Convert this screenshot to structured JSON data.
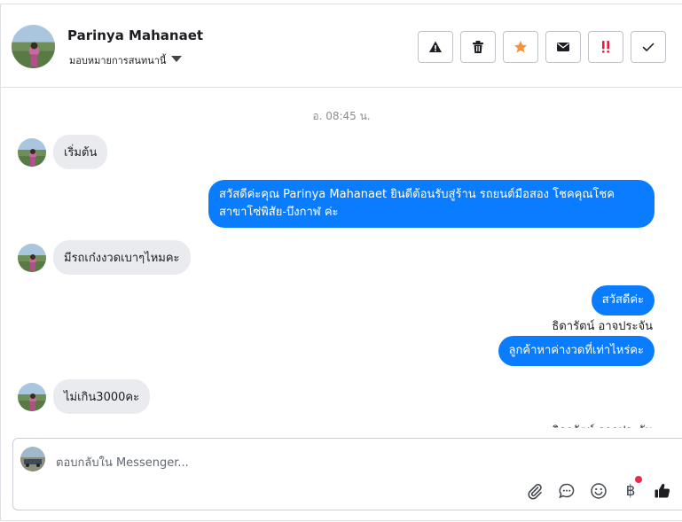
{
  "header": {
    "contact_name": "Parinya Mahanaet",
    "assign_label": "มอบหมายการสนทนานี้",
    "actions": [
      {
        "icon": "warning-icon",
        "color": "#1c1e21"
      },
      {
        "icon": "trash-icon",
        "color": "#1c1e21"
      },
      {
        "icon": "star-icon",
        "color": "#f7923a"
      },
      {
        "icon": "mail-icon",
        "color": "#1c1e21"
      },
      {
        "icon": "exclamation-icon",
        "color": "#e41e3f"
      },
      {
        "icon": "check-icon",
        "color": "#1c1e21"
      }
    ]
  },
  "conversation": {
    "timestamp": "อ. 08:45 น.",
    "messages": [
      {
        "direction": "in",
        "text": "เริ่มต้น"
      },
      {
        "direction": "out",
        "text": "สวัสดีค่ะคุณ Parinya Mahanaet ยินดีต้อนรับสู่ร้าน รถยนต์มือสอง โชคคุณโชค สาขาโซ่พิสัย-บึงกาฬ ค่ะ"
      },
      {
        "direction": "in",
        "text": "มีรถเก๋งงวดเบาๆไหมคะ"
      },
      {
        "direction": "out",
        "text": "สวัสดีค่ะ"
      },
      {
        "direction": "out",
        "text": "ลูกค้าหาค่างวดที่เท่าไหร่คะ"
      },
      {
        "direction": "in",
        "text": "ไม่เกิน3000คะ"
      }
    ],
    "sender_label": "ธิดารัตน์ อาจประจัน",
    "sender_label_partial": "ธิดารัตน์ อาจประจัน"
  },
  "composer": {
    "placeholder": "ตอบกลับใน Messenger...",
    "tools": [
      "paperclip-icon",
      "chat-bubble-icon",
      "smiley-icon",
      "baht-icon",
      "thumbs-up-icon"
    ],
    "baht_symbol": "฿",
    "notification_color": "#f02849"
  },
  "colors": {
    "outgoing_bubble": "#0a7cff",
    "incoming_bubble": "#e9ebee",
    "border": "#dddfe2"
  }
}
